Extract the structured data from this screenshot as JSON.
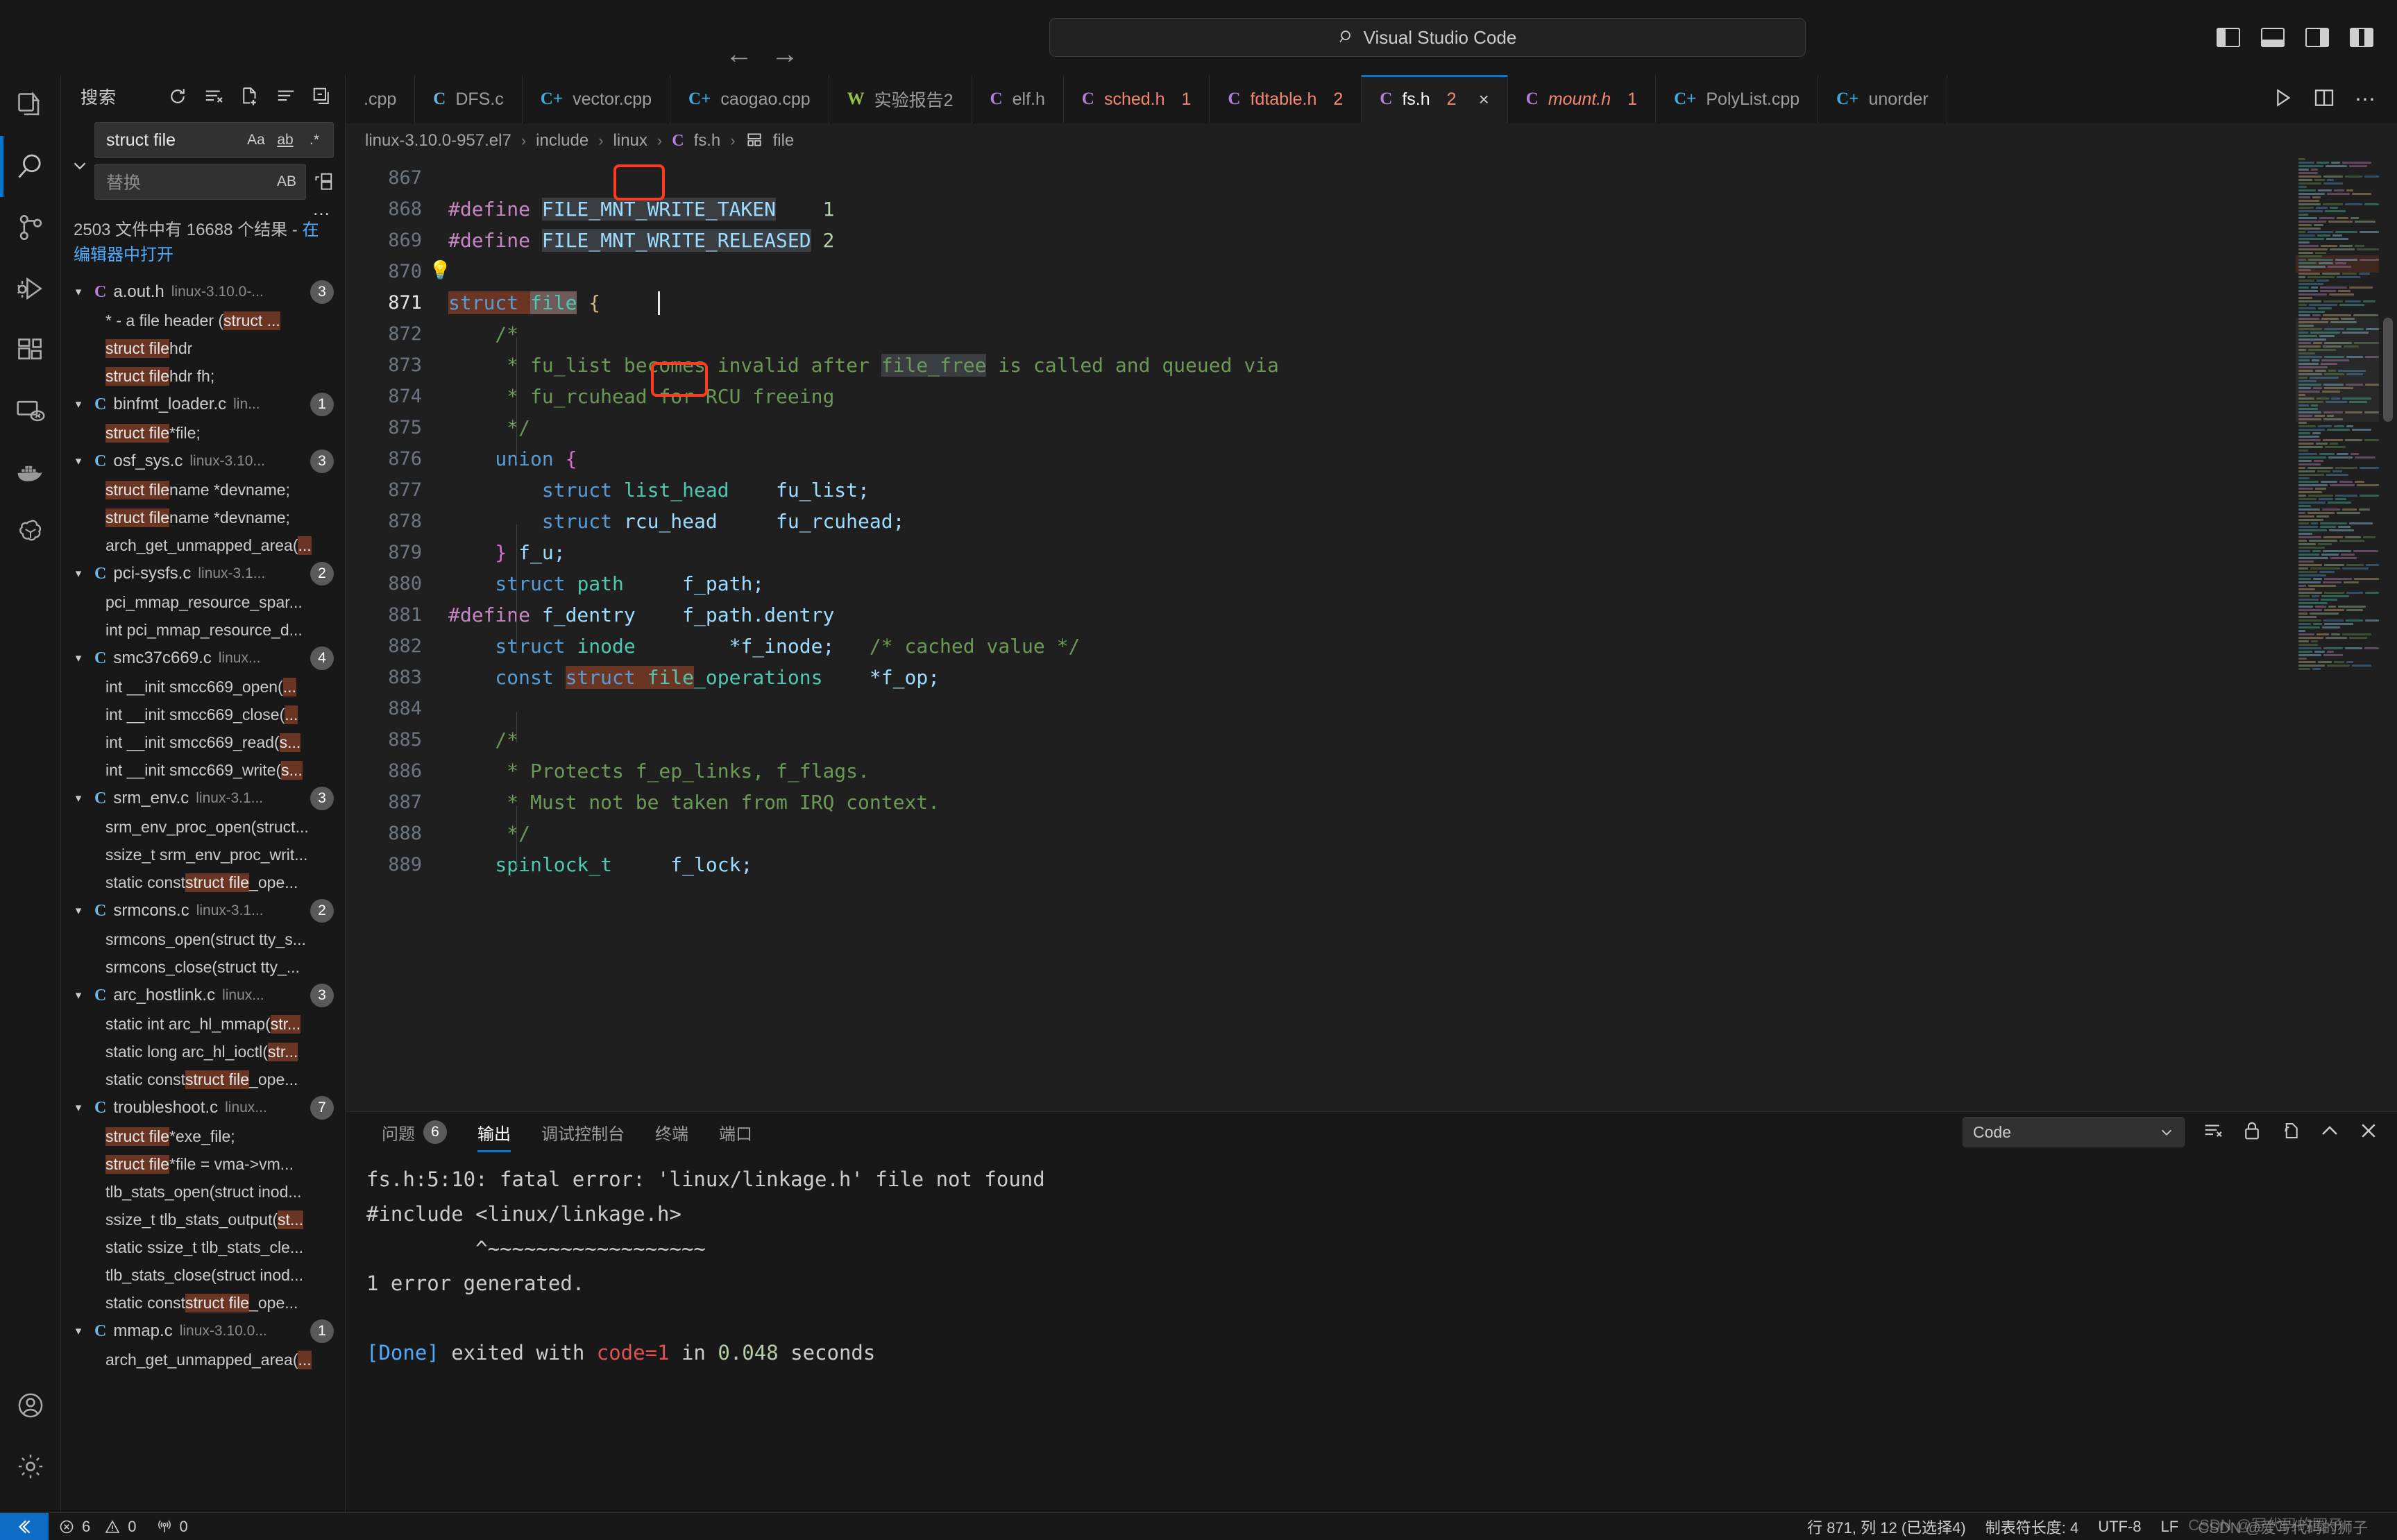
{
  "titlebar": {
    "back_icon": "arrow-left-icon",
    "forward_icon": "arrow-right-icon",
    "search_placeholder": "Visual Studio Code",
    "search_value": "Visual Studio Code",
    "search_icon": "magnifier-icon"
  },
  "activitybar": {
    "items": [
      {
        "name": "explorer",
        "icon": "files-icon",
        "active": false
      },
      {
        "name": "search",
        "icon": "search-icon",
        "active": true
      },
      {
        "name": "source-control",
        "icon": "source-control-icon",
        "active": false
      },
      {
        "name": "run-and-debug",
        "icon": "run-debug-icon",
        "active": false
      },
      {
        "name": "extensions",
        "icon": "extensions-icon",
        "active": false
      },
      {
        "name": "remote-explorer",
        "icon": "remote-explorer-icon",
        "active": false
      },
      {
        "name": "docker",
        "icon": "docker-whale-icon",
        "active": false
      },
      {
        "name": "chatgpt",
        "icon": "openai-icon",
        "active": false
      }
    ],
    "bottom": [
      {
        "name": "accounts",
        "icon": "account-icon"
      },
      {
        "name": "manage",
        "icon": "gear-icon"
      }
    ]
  },
  "sidebar": {
    "title": "搜索",
    "actions": [
      {
        "name": "refresh",
        "icon": "refresh-icon"
      },
      {
        "name": "clear-search-results",
        "icon": "clear-all-icon"
      },
      {
        "name": "open-new-search-editor",
        "icon": "new-file-icon"
      },
      {
        "name": "view-as-list",
        "icon": "list-icon"
      },
      {
        "name": "collapse-all",
        "icon": "collapse-all-icon"
      }
    ],
    "search": {
      "value": "struct file",
      "placeholder": "搜索",
      "toggles": [
        {
          "name": "match-case",
          "label": "Aa",
          "active": false
        },
        {
          "name": "match-whole-word",
          "label": "ab",
          "active": false
        },
        {
          "name": "use-regex",
          "label": ".*",
          "active": false
        }
      ]
    },
    "replace": {
      "value": "",
      "placeholder": "替换",
      "toggles": [
        {
          "name": "preserve-case",
          "label": "AB",
          "active": false
        }
      ],
      "replace_all_icon": "replace-all-icon"
    },
    "toggle_replace_icon": "chevron-down-icon",
    "more_icon": "ellipsis-icon",
    "summary_text": "2503 文件中有 16688 个结果 - ",
    "summary_link": "在编辑器中打开",
    "results": [
      {
        "type": "file",
        "icon_letter": "C",
        "icon_color": "#b180d7",
        "name": "a.out.h",
        "path": "linux-3.10.0-...",
        "count": "3",
        "expanded": true
      },
      {
        "type": "line",
        "pre": "*      - a file header (",
        "hl": "struct ...",
        "post": ""
      },
      {
        "type": "line",
        "pre": "",
        "hl": "struct file",
        "post": "hdr"
      },
      {
        "type": "line",
        "pre": "",
        "hl": "struct file",
        "post": "hdr        fh;"
      },
      {
        "type": "file",
        "icon_letter": "C",
        "icon_color": "#6cb6e0",
        "name": "binfmt_loader.c",
        "path": "lin...",
        "count": "1",
        "expanded": true
      },
      {
        "type": "line",
        "pre": "",
        "hl": "struct file",
        "post": " *file;"
      },
      {
        "type": "file",
        "icon_letter": "C",
        "icon_color": "#6cb6e0",
        "name": "osf_sys.c",
        "path": "linux-3.10...",
        "count": "3",
        "expanded": true
      },
      {
        "type": "line",
        "pre": "",
        "hl": "struct file",
        "post": "name *devname;"
      },
      {
        "type": "line",
        "pre": "",
        "hl": "struct file",
        "post": "name *devname;"
      },
      {
        "type": "line",
        "pre": "arch_get_unmapped_area(",
        "hl": "...",
        "post": ""
      },
      {
        "type": "file",
        "icon_letter": "C",
        "icon_color": "#6cb6e0",
        "name": "pci-sysfs.c",
        "path": "linux-3.1...",
        "count": "2",
        "expanded": true
      },
      {
        "type": "line",
        "pre": "pci_mmap_resource_spar...",
        "hl": "",
        "post": ""
      },
      {
        "type": "line",
        "pre": "int pci_mmap_resource_d...",
        "hl": "",
        "post": ""
      },
      {
        "type": "file",
        "icon_letter": "C",
        "icon_color": "#6cb6e0",
        "name": "smc37c669.c",
        "path": "linux...",
        "count": "4",
        "expanded": true
      },
      {
        "type": "line",
        "pre": "int __init smcc669_open( ",
        "hl": "...",
        "post": ""
      },
      {
        "type": "line",
        "pre": "int __init smcc669_close( ",
        "hl": "...",
        "post": ""
      },
      {
        "type": "line",
        "pre": "int __init smcc669_read( ",
        "hl": "s...",
        "post": ""
      },
      {
        "type": "line",
        "pre": "int __init smcc669_write( ",
        "hl": "s...",
        "post": ""
      },
      {
        "type": "file",
        "icon_letter": "C",
        "icon_color": "#6cb6e0",
        "name": "srm_env.c",
        "path": "linux-3.1...",
        "count": "3",
        "expanded": true
      },
      {
        "type": "line",
        "pre": "srm_env_proc_open(struct...",
        "hl": "",
        "post": ""
      },
      {
        "type": "line",
        "pre": "ssize_t srm_env_proc_writ...",
        "hl": "",
        "post": ""
      },
      {
        "type": "line",
        "pre": "static const ",
        "hl": "struct file",
        "post": "_ope..."
      },
      {
        "type": "file",
        "icon_letter": "C",
        "icon_color": "#6cb6e0",
        "name": "srmcons.c",
        "path": "linux-3.1...",
        "count": "2",
        "expanded": true
      },
      {
        "type": "line",
        "pre": "srmcons_open(struct tty_s...",
        "hl": "",
        "post": ""
      },
      {
        "type": "line",
        "pre": "srmcons_close(struct tty_...",
        "hl": "",
        "post": ""
      },
      {
        "type": "file",
        "icon_letter": "C",
        "icon_color": "#6cb6e0",
        "name": "arc_hostlink.c",
        "path": "linux...",
        "count": "3",
        "expanded": true
      },
      {
        "type": "line",
        "pre": "static int arc_hl_mmap(",
        "hl": "str...",
        "post": ""
      },
      {
        "type": "line",
        "pre": "static long arc_hl_ioctl(",
        "hl": "str...",
        "post": ""
      },
      {
        "type": "line",
        "pre": "static const ",
        "hl": "struct file",
        "post": "_ope..."
      },
      {
        "type": "file",
        "icon_letter": "C",
        "icon_color": "#6cb6e0",
        "name": "troubleshoot.c",
        "path": "linux...",
        "count": "7",
        "expanded": true
      },
      {
        "type": "line",
        "pre": "",
        "hl": "struct file",
        "post": " *exe_file;"
      },
      {
        "type": "line",
        "pre": "",
        "hl": "struct file",
        "post": " *file = vma->vm..."
      },
      {
        "type": "line",
        "pre": "tlb_stats_open(struct inod...",
        "hl": "",
        "post": ""
      },
      {
        "type": "line",
        "pre": "ssize_t tlb_stats_output(",
        "hl": "st...",
        "post": ""
      },
      {
        "type": "line",
        "pre": "static ssize_t tlb_stats_cle...",
        "hl": "",
        "post": ""
      },
      {
        "type": "line",
        "pre": "tlb_stats_close(struct inod...",
        "hl": "",
        "post": ""
      },
      {
        "type": "line",
        "pre": "static const ",
        "hl": "struct file",
        "post": "_ope..."
      },
      {
        "type": "file",
        "icon_letter": "C",
        "icon_color": "#6cb6e0",
        "name": "mmap.c",
        "path": "linux-3.10.0...",
        "count": "1",
        "expanded": true
      },
      {
        "type": "line",
        "pre": "arch_get_unmapped_area(",
        "hl": "...",
        "post": ""
      }
    ]
  },
  "tabs": {
    "items": [
      {
        "name": "tab-cpp",
        "icon": "",
        "icon_color": "",
        "label": ".cpp",
        "badge": "",
        "active": false,
        "italic": false,
        "error": false
      },
      {
        "name": "tab-dfs-c",
        "icon": "C",
        "icon_color": "#6cb6e0",
        "label": "DFS.c",
        "badge": "",
        "active": false,
        "italic": false,
        "error": false
      },
      {
        "name": "tab-vector-cpp",
        "icon": "C+",
        "icon_color": "#3caee0",
        "label": "vector.cpp",
        "badge": "",
        "active": false,
        "italic": false,
        "error": false
      },
      {
        "name": "tab-caogao-cpp",
        "icon": "C+",
        "icon_color": "#3caee0",
        "label": "caogao.cpp",
        "badge": "",
        "active": false,
        "italic": false,
        "error": false
      },
      {
        "name": "tab-shiyanbaogao2",
        "icon": "W",
        "icon_color": "#9bbf44",
        "label": "实验报告2",
        "badge": "",
        "active": false,
        "italic": false,
        "error": false
      },
      {
        "name": "tab-elf-h",
        "icon": "C",
        "icon_color": "#b180d7",
        "label": "elf.h",
        "badge": "",
        "active": false,
        "italic": false,
        "error": false
      },
      {
        "name": "tab-sched-h",
        "icon": "C",
        "icon_color": "#b180d7",
        "label": "sched.h",
        "badge": "1",
        "active": false,
        "italic": false,
        "error": true
      },
      {
        "name": "tab-fdtable-h",
        "icon": "C",
        "icon_color": "#b180d7",
        "label": "fdtable.h",
        "badge": "2",
        "active": false,
        "italic": false,
        "error": true
      },
      {
        "name": "tab-fs-h",
        "icon": "C",
        "icon_color": "#b180d7",
        "label": "fs.h",
        "badge": "2",
        "active": true,
        "italic": false,
        "error": false
      },
      {
        "name": "tab-mount-h",
        "icon": "C",
        "icon_color": "#b180d7",
        "label": "mount.h",
        "badge": "1",
        "active": false,
        "italic": true,
        "error": true
      },
      {
        "name": "tab-polylist-cpp",
        "icon": "C+",
        "icon_color": "#3caee0",
        "label": "PolyList.cpp",
        "badge": "",
        "active": false,
        "italic": false,
        "error": false
      },
      {
        "name": "tab-unorder",
        "icon": "C+",
        "icon_color": "#3caee0",
        "label": "unorder",
        "badge": "",
        "active": false,
        "italic": false,
        "error": false
      }
    ],
    "close_label": "×",
    "actions": [
      {
        "name": "run-code-button",
        "icon": "play-icon"
      },
      {
        "name": "split-editor-button",
        "icon": "split-editor-icon"
      },
      {
        "name": "more-actions-button",
        "icon": "ellipsis-icon"
      }
    ]
  },
  "breadcrumb": {
    "items": [
      "linux-3.10.0-957.el7",
      "include",
      "linux",
      "fs.h",
      "file"
    ],
    "file_icon_letter": "C",
    "symbol_icon": "struct-icon"
  },
  "editor": {
    "first_line": 867,
    "lines": [
      {
        "n": 867,
        "tokens": []
      },
      {
        "n": 868,
        "tokens": [
          {
            "t": "#define ",
            "c": "mac"
          },
          {
            "t": "FILE_MNT_WRITE_TAKEN",
            "c": "var sel"
          },
          {
            "t": "    ",
            "c": "pl"
          },
          {
            "t": "1",
            "c": "num2"
          }
        ]
      },
      {
        "n": 869,
        "tokens": [
          {
            "t": "#define ",
            "c": "mac"
          },
          {
            "t": "FILE_MNT_WRITE_RELEASED",
            "c": "var sel"
          },
          {
            "t": " ",
            "c": "pl"
          },
          {
            "t": "2",
            "c": "num2"
          }
        ]
      },
      {
        "n": 870,
        "tokens": []
      },
      {
        "n": 871,
        "tokens": [
          {
            "t": "struct ",
            "c": "kw hl"
          },
          {
            "t": "file",
            "c": "type cur"
          },
          {
            "t": " {",
            "c": "br"
          }
        ]
      },
      {
        "n": 872,
        "tokens": [
          {
            "t": "    /*",
            "c": "cmt"
          }
        ]
      },
      {
        "n": 873,
        "tokens": [
          {
            "t": "     * fu_list becomes invalid after ",
            "c": "cmt"
          },
          {
            "t": "file_free",
            "c": "cmt sel"
          },
          {
            "t": " is called and queued via",
            "c": "cmt"
          }
        ]
      },
      {
        "n": 874,
        "tokens": [
          {
            "t": "     * fu_rcuhead for RCU freeing",
            "c": "cmt"
          }
        ]
      },
      {
        "n": 875,
        "tokens": [
          {
            "t": "     */",
            "c": "cmt"
          }
        ]
      },
      {
        "n": 876,
        "tokens": [
          {
            "t": "    union ",
            "c": "kw"
          },
          {
            "t": "{",
            "c": "brace"
          }
        ]
      },
      {
        "n": 877,
        "tokens": [
          {
            "t": "        struct ",
            "c": "kw"
          },
          {
            "t": "list_head",
            "c": "type"
          },
          {
            "t": "    fu_list;",
            "c": "var"
          }
        ]
      },
      {
        "n": 878,
        "tokens": [
          {
            "t": "        struct ",
            "c": "kw"
          },
          {
            "t": "rcu_head",
            "c": "var"
          },
          {
            "t": "     fu_rcuhead;",
            "c": "var"
          }
        ]
      },
      {
        "n": 879,
        "tokens": [
          {
            "t": "    }",
            "c": "brace"
          },
          {
            "t": " f_u;",
            "c": "var"
          }
        ]
      },
      {
        "n": 880,
        "tokens": [
          {
            "t": "    struct ",
            "c": "kw"
          },
          {
            "t": "path",
            "c": "type"
          },
          {
            "t": "     f_path;",
            "c": "var"
          }
        ]
      },
      {
        "n": 881,
        "tokens": [
          {
            "t": "#define ",
            "c": "mac"
          },
          {
            "t": "f_dentry",
            "c": "var"
          },
          {
            "t": "    f_path.dentry",
            "c": "var"
          }
        ]
      },
      {
        "n": 882,
        "tokens": [
          {
            "t": "    struct ",
            "c": "kw"
          },
          {
            "t": "inode",
            "c": "type box"
          },
          {
            "t": "        *f_inode;",
            "c": "var"
          },
          {
            "t": "   /* cached value */",
            "c": "cmt"
          }
        ]
      },
      {
        "n": 883,
        "tokens": [
          {
            "t": "    const ",
            "c": "kw"
          },
          {
            "t": "struct ",
            "c": "kw hl"
          },
          {
            "t": "file",
            "c": "type hl"
          },
          {
            "t": "_operations",
            "c": "type"
          },
          {
            "t": "    *f_op;",
            "c": "var"
          }
        ]
      },
      {
        "n": 884,
        "tokens": []
      },
      {
        "n": 885,
        "tokens": [
          {
            "t": "    /*",
            "c": "cmt"
          }
        ]
      },
      {
        "n": 886,
        "tokens": [
          {
            "t": "     * Protects f_ep_links, f_flags.",
            "c": "cmt"
          }
        ]
      },
      {
        "n": 887,
        "tokens": [
          {
            "t": "     * Must not be taken from IRQ context.",
            "c": "cmt"
          }
        ]
      },
      {
        "n": 888,
        "tokens": [
          {
            "t": "     */",
            "c": "cmt"
          }
        ]
      },
      {
        "n": 889,
        "tokens": [
          {
            "t": "    spinlock_t",
            "c": "type"
          },
          {
            "t": "     f_lock;",
            "c": "var"
          }
        ]
      }
    ],
    "lightbulb_line": 870,
    "highlight_word": "file",
    "boxed_words": [
      "file",
      "inode"
    ]
  },
  "panel": {
    "tabs": [
      {
        "name": "problems",
        "label": "问题",
        "badge": "6",
        "active": false
      },
      {
        "name": "output",
        "label": "输出",
        "badge": "",
        "active": true
      },
      {
        "name": "debug-console",
        "label": "调试控制台",
        "badge": "",
        "active": false
      },
      {
        "name": "terminal",
        "label": "终端",
        "badge": "",
        "active": false
      },
      {
        "name": "ports",
        "label": "端口",
        "badge": "",
        "active": false
      }
    ],
    "channel_select": "Code",
    "actions": [
      {
        "name": "clear-output-button",
        "icon": "clear-all-icon"
      },
      {
        "name": "turn-auto-scrolling-off-button",
        "icon": "lock-icon"
      },
      {
        "name": "open-output-in-editor-button",
        "icon": "open-in-editor-icon"
      },
      {
        "name": "maximize-panel-button",
        "icon": "chevron-up-icon"
      },
      {
        "name": "close-panel-button",
        "icon": "close-icon"
      }
    ],
    "output_lines": [
      {
        "segments": [
          {
            "t": "fs.h:5:10: fatal error: 'linux/linkage.h' file not found",
            "c": ""
          }
        ]
      },
      {
        "segments": [
          {
            "t": "#include <linux/linkage.h>",
            "c": ""
          }
        ]
      },
      {
        "segments": [
          {
            "t": "         ^~~~~~~~~~~~~~~~~~~",
            "c": "squig"
          }
        ]
      },
      {
        "segments": [
          {
            "t": "1 error generated.",
            "c": ""
          }
        ]
      },
      {
        "segments": [
          {
            "t": "",
            "c": ""
          }
        ]
      },
      {
        "segments": [
          {
            "t": "[Done]",
            "c": "blue"
          },
          {
            "t": " exited with ",
            "c": ""
          },
          {
            "t": "code=1",
            "c": "red"
          },
          {
            "t": " in ",
            "c": ""
          },
          {
            "t": "0.048",
            "c": "green"
          },
          {
            "t": " seconds",
            "c": ""
          }
        ]
      }
    ]
  },
  "statusbar": {
    "remote_icon": "remote-window-icon",
    "errors_icon": "error-icon",
    "errors": "6",
    "warnings_icon": "warning-icon",
    "warnings": "0",
    "radio_icon": "radio-tower-icon",
    "radio": "0",
    "cursor_position": "行 871, 列 12 (已选择4)",
    "indentation": "制表符长度: 4",
    "encoding": "UTF-8",
    "eol": "LF",
    "watermark": "CSDN @爱写代码的狮子",
    "watermark_overlay": "CSDN @写代码的圈子"
  }
}
